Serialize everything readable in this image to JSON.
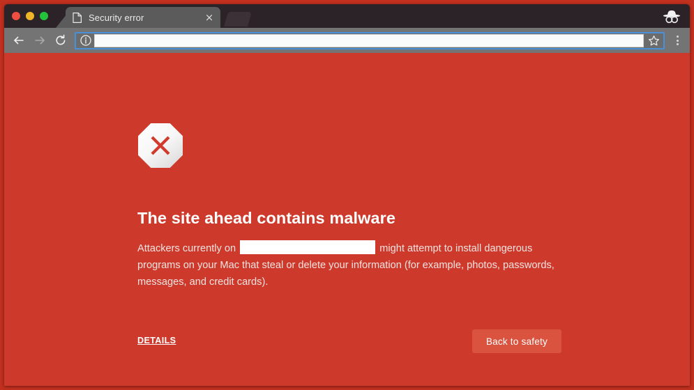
{
  "window": {
    "traffic_lights": [
      {
        "name": "close",
        "color": "#ef4f42"
      },
      {
        "name": "minimize",
        "color": "#f0b429"
      },
      {
        "name": "zoom",
        "color": "#24c33c"
      }
    ]
  },
  "tabstrip": {
    "active_tab": {
      "title": "Security error",
      "favicon": "page-icon",
      "close_label": "×"
    },
    "new_tab_label": "",
    "incognito_icon": "incognito-icon"
  },
  "toolbar": {
    "back_icon": "back-arrow-icon",
    "forward_icon": "forward-arrow-icon",
    "reload_icon": "reload-icon",
    "omnibox": {
      "security_icon": "info-circle-icon",
      "value": "",
      "placeholder": "",
      "redacted": true
    },
    "bookmark_icon": "star-icon",
    "menu_icon": "three-dot-menu-icon"
  },
  "interstitial": {
    "icon": "octagon-error-icon",
    "title": "The site ahead contains malware",
    "body_before": "Attackers currently on",
    "body_redacted": true,
    "body_after": "might attempt to install dangerous programs on your Mac that steal or delete your information (for example, photos, passwords, messages, and credit cards).",
    "details_label": "DETAILS",
    "back_to_safety_label": "Back to safety"
  },
  "colors": {
    "page_background": "#cd3a2c",
    "frame": "#c2301f",
    "tabstrip": "#2b2327",
    "toolbar": "#747474",
    "active_tab": "#5b5b5b",
    "omnibox_focus_ring": "#4a90d9",
    "button": "#d9533f",
    "text": "#ffffff"
  }
}
